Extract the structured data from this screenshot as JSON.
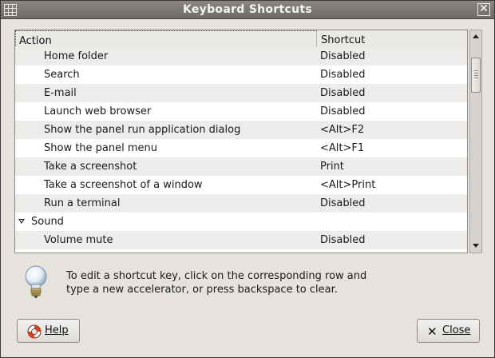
{
  "window": {
    "title": "Keyboard Shortcuts"
  },
  "columns": {
    "action": "Action",
    "shortcut": "Shortcut"
  },
  "rows": [
    {
      "action": "Home folder",
      "shortcut": "Disabled",
      "group": false
    },
    {
      "action": "Search",
      "shortcut": "Disabled",
      "group": false
    },
    {
      "action": "E-mail",
      "shortcut": "Disabled",
      "group": false
    },
    {
      "action": "Launch web browser",
      "shortcut": "Disabled",
      "group": false
    },
    {
      "action": "Show the panel run application dialog",
      "shortcut": "<Alt>F2",
      "group": false
    },
    {
      "action": "Show the panel menu",
      "shortcut": "<Alt>F1",
      "group": false
    },
    {
      "action": "Take a screenshot",
      "shortcut": "Print",
      "group": false
    },
    {
      "action": "Take a screenshot of a window",
      "shortcut": "<Alt>Print",
      "group": false
    },
    {
      "action": "Run a terminal",
      "shortcut": "Disabled",
      "group": false
    },
    {
      "action": "Sound",
      "shortcut": "",
      "group": true
    },
    {
      "action": "Volume mute",
      "shortcut": "Disabled",
      "group": false
    }
  ],
  "hint": {
    "line1": "To edit a shortcut key, click on the corresponding row and",
    "line2": "type a new accelerator, or press backspace to clear."
  },
  "buttons": {
    "help_label": "Help",
    "close_label": "Close"
  },
  "icons": {
    "window_menu": "window-menu-icon",
    "window_close": "close-icon",
    "expander": "expander-down-icon",
    "hint": "lightbulb-icon",
    "help": "lifebuoy-icon",
    "close": "x-icon"
  }
}
